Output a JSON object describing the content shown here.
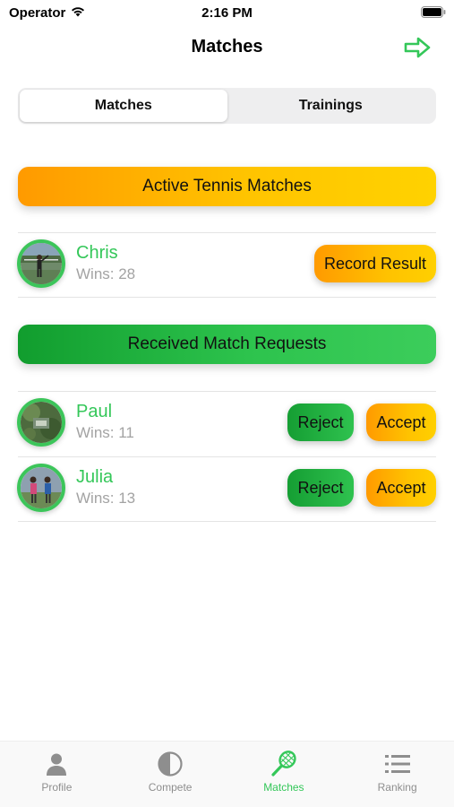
{
  "status_bar": {
    "carrier": "Operator",
    "time": "2:16 PM"
  },
  "nav": {
    "title": "Matches",
    "forward_icon": "arrow-right-icon"
  },
  "segments": [
    {
      "label": "Matches",
      "selected": true
    },
    {
      "label": "Trainings",
      "selected": false
    }
  ],
  "active_section": {
    "title": "Active Tennis Matches",
    "players": [
      {
        "name": "Chris",
        "wins": "Wins: 28",
        "action_label": "Record Result"
      }
    ]
  },
  "requests_section": {
    "title": "Received Match Requests",
    "players": [
      {
        "name": "Paul",
        "wins": "Wins: 11",
        "reject_label": "Reject",
        "accept_label": "Accept"
      },
      {
        "name": "Julia",
        "wins": "Wins: 13",
        "reject_label": "Reject",
        "accept_label": "Accept"
      }
    ]
  },
  "tab_bar": [
    {
      "label": "Profile",
      "icon": "person-icon",
      "active": false
    },
    {
      "label": "Compete",
      "icon": "half-circle-icon",
      "active": false
    },
    {
      "label": "Matches",
      "icon": "tennis-racket-icon",
      "active": true
    },
    {
      "label": "Ranking",
      "icon": "list-icon",
      "active": false
    }
  ],
  "colors": {
    "accent_green": "#34c759",
    "accent_orange": "#ff9a00",
    "accent_yellow": "#ffd200",
    "inactive_gray": "#8e8e8e"
  }
}
